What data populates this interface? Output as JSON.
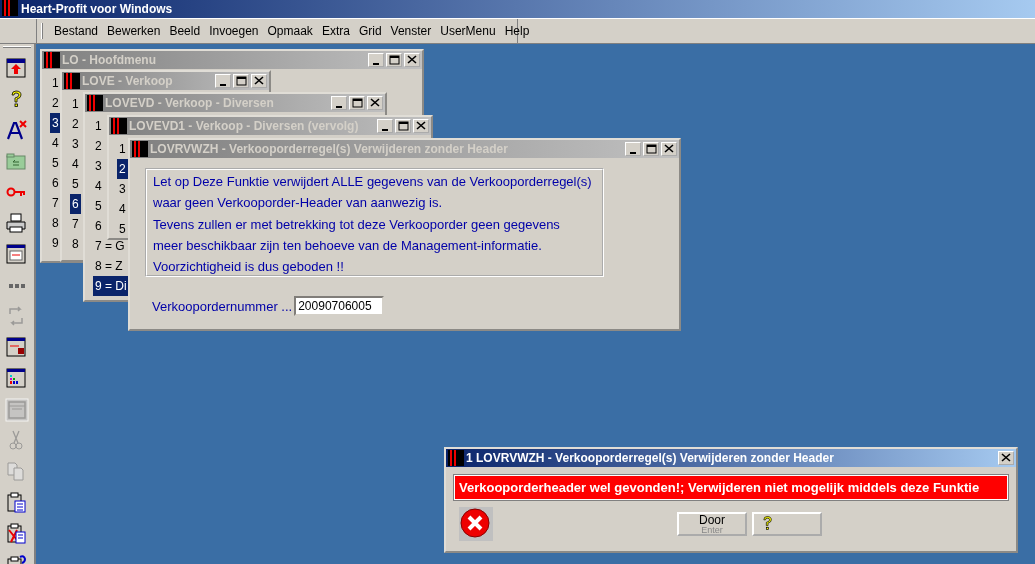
{
  "app": {
    "title": "Heart-Profit voor Windows"
  },
  "menu": [
    "Bestand",
    "Bewerken",
    "Beeld",
    "Invoegen",
    "Opmaak",
    "Extra",
    "Grid",
    "Venster",
    "UserMenu",
    "Help"
  ],
  "toolbar": [
    {
      "kind": "window-arrow",
      "disabled": false
    },
    {
      "kind": "help",
      "disabled": false
    },
    {
      "kind": "font-x",
      "disabled": false
    },
    {
      "kind": "folder",
      "disabled": false
    },
    {
      "kind": "key",
      "disabled": false
    },
    {
      "kind": "printer",
      "disabled": false
    },
    {
      "kind": "window-list",
      "disabled": false
    },
    {
      "kind": "dots",
      "disabled": false
    },
    {
      "kind": "refresh",
      "disabled": true
    },
    {
      "kind": "window-lock",
      "disabled": false
    },
    {
      "kind": "chart-window",
      "disabled": false
    },
    {
      "kind": "frame",
      "disabled": true
    },
    {
      "kind": "scissors",
      "disabled": true
    },
    {
      "kind": "copy",
      "disabled": true
    },
    {
      "kind": "paste",
      "disabled": false
    },
    {
      "kind": "paste-x",
      "disabled": false
    },
    {
      "kind": "clipboard-help",
      "disabled": false
    }
  ],
  "windows": [
    {
      "title": "LO - Hoofdmenu",
      "active": false,
      "items": [
        {
          "label": "1",
          "selected": false
        },
        {
          "label": "2",
          "selected": false
        },
        {
          "label": "3",
          "selected": true
        },
        {
          "label": "4",
          "selected": false
        },
        {
          "label": "5",
          "selected": false
        },
        {
          "label": "6",
          "selected": false
        },
        {
          "label": "7",
          "selected": false
        },
        {
          "label": "8",
          "selected": false
        },
        {
          "label": "9",
          "selected": false
        }
      ]
    },
    {
      "title": "LOVE - Verkoop",
      "active": false,
      "items": [
        {
          "label": "1",
          "selected": false
        },
        {
          "label": "2",
          "selected": false
        },
        {
          "label": "3",
          "selected": false
        },
        {
          "label": "4",
          "selected": false
        },
        {
          "label": "5",
          "selected": false
        },
        {
          "label": "6",
          "selected": true
        },
        {
          "label": "7",
          "selected": false
        },
        {
          "label": "8",
          "selected": false
        }
      ]
    },
    {
      "title": "LOVEVD - Verkoop - Diversen",
      "active": false,
      "items": [
        {
          "label": "1",
          "selected": false
        },
        {
          "label": "2",
          "selected": false
        },
        {
          "label": "3",
          "selected": false
        },
        {
          "label": "4",
          "selected": false
        },
        {
          "label": "5",
          "selected": false
        },
        {
          "label": "6",
          "selected": false
        },
        {
          "label": "7 = G",
          "selected": false
        },
        {
          "label": "8 = Z",
          "selected": false
        },
        {
          "label": "9 = Di",
          "selected": true
        }
      ]
    },
    {
      "title": "LOVEVD1 - Verkoop - Diversen (vervolg)",
      "active": false,
      "items": [
        {
          "label": "1",
          "selected": false
        },
        {
          "label": "2",
          "selected": true
        },
        {
          "label": "3",
          "selected": false
        },
        {
          "label": "4",
          "selected": false
        },
        {
          "label": "5",
          "selected": false
        }
      ]
    }
  ],
  "dialog": {
    "title": "LOVRVWZH - Verkooporderregel(s) Verwijderen zonder Header",
    "active": false,
    "message_lines": [
      "Let op  Deze Funktie verwijdert ALLE gegevens van de Verkooporderregel(s)",
      "waar geen Verkooporder-Header van aanwezig is.",
      "Tevens zullen er met betrekking tot deze Verkooporder geen gegevens",
      "meer beschikbaar zijn ten behoeve van de Management-informatie.",
      "Voorzichtigheid is dus geboden !!"
    ],
    "field": {
      "label": "Verkoopordernummer ...",
      "value": "20090706005"
    }
  },
  "alert": {
    "title": "1 LOVRVWZH - Verkooporderregel(s) Verwijderen zonder Header",
    "active": true,
    "message": "Verkooporderheader wel gevonden!; Verwijderen niet mogelijk middels deze Funktie",
    "buttons": [
      {
        "kind": "text",
        "label": "Door",
        "hint": "Enter"
      },
      {
        "kind": "help"
      }
    ]
  }
}
